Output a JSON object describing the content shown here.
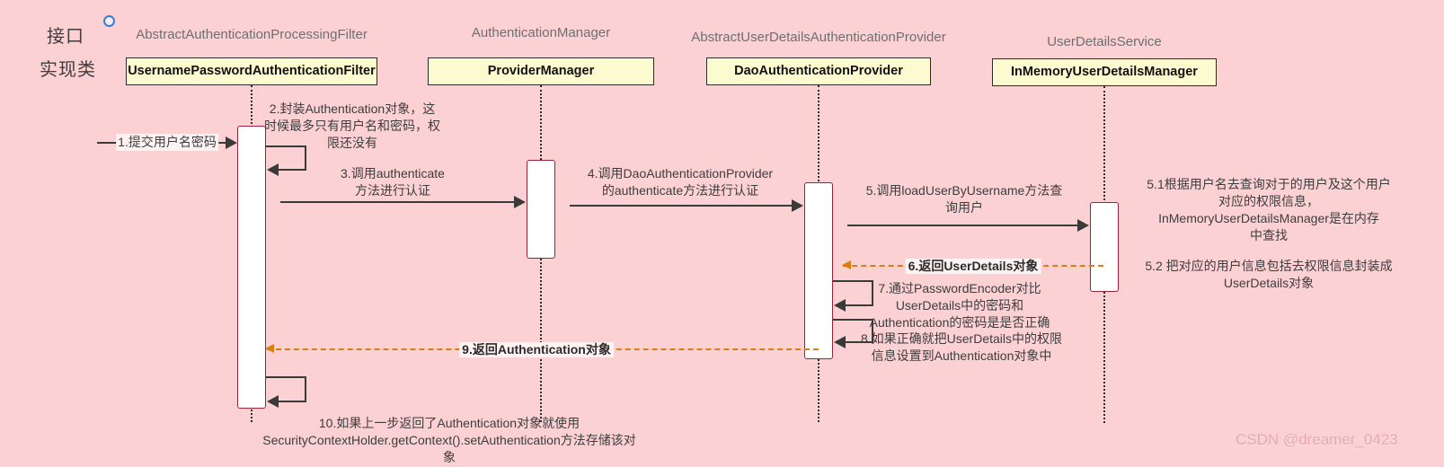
{
  "diagram": {
    "title": "Spring Security Authentication Sequence Diagram",
    "background_color": "#fbd1d4",
    "actor_fill": "#fcfbd0",
    "activation_fill": "#ffffff",
    "activation_border": "#9b2335",
    "call_color": "#3a3a3a",
    "return_color": "#d97f12"
  },
  "side_labels": {
    "interface": "接口",
    "implementation": "实现类"
  },
  "lifelines": [
    {
      "stereotype": "AbstractAuthenticationProcessingFilter",
      "name": "UsernamePasswordAuthenticationFilter"
    },
    {
      "stereotype": "AuthenticationManager",
      "name": "ProviderManager"
    },
    {
      "stereotype": "AbstractUserDetailsAuthenticationProvider",
      "name": "DaoAuthenticationProvider"
    },
    {
      "stereotype": "UserDetailsService",
      "name": "InMemoryUserDetailsManager"
    }
  ],
  "messages": [
    {
      "id": "m1",
      "label": "1.提交用户名密码",
      "kind": "call"
    },
    {
      "id": "m2",
      "label": "2.封装Authentication对象，这\n时候最多只有用户名和密码，权\n限还没有",
      "kind": "self-note"
    },
    {
      "id": "m3",
      "label": "3.调用authenticate\n方法进行认证",
      "kind": "call"
    },
    {
      "id": "m4",
      "label": "4.调用DaoAuthenticationProvider\n的authenticate方法进行认证",
      "kind": "call"
    },
    {
      "id": "m5",
      "label": "5.调用loadUserByUsername方法查\n询用户",
      "kind": "call"
    },
    {
      "id": "m5_1",
      "label": "5.1根据用户名去查询对于的用户及这个用户\n对应的权限信息，\nInMemoryUserDetailsManager是在内存\n中查找",
      "kind": "note"
    },
    {
      "id": "m5_2",
      "label": "5.2 把对应的用户信息包括去权限信息封装成\nUserDetails对象",
      "kind": "note"
    },
    {
      "id": "m6",
      "label": "6.返回UserDetails对象",
      "kind": "return"
    },
    {
      "id": "m7",
      "label": "7.通过PasswordEncoder对比\nUserDetails中的密码和\nAuthentication的密码是是否正确",
      "kind": "self-note"
    },
    {
      "id": "m8",
      "label": "8.如果正确就把UserDetails中的权限\n信息设置到Authentication对象中",
      "kind": "self-note"
    },
    {
      "id": "m9",
      "label": "9.返回Authentication对象",
      "kind": "return"
    },
    {
      "id": "m10",
      "label": "10.如果上一步返回了Authentication对象就使用\nSecurityContextHolder.getContext().setAuthentication方法存储该对\n象",
      "kind": "note"
    }
  ],
  "watermark": {
    "text": "CSDN @dreamer_0423"
  }
}
